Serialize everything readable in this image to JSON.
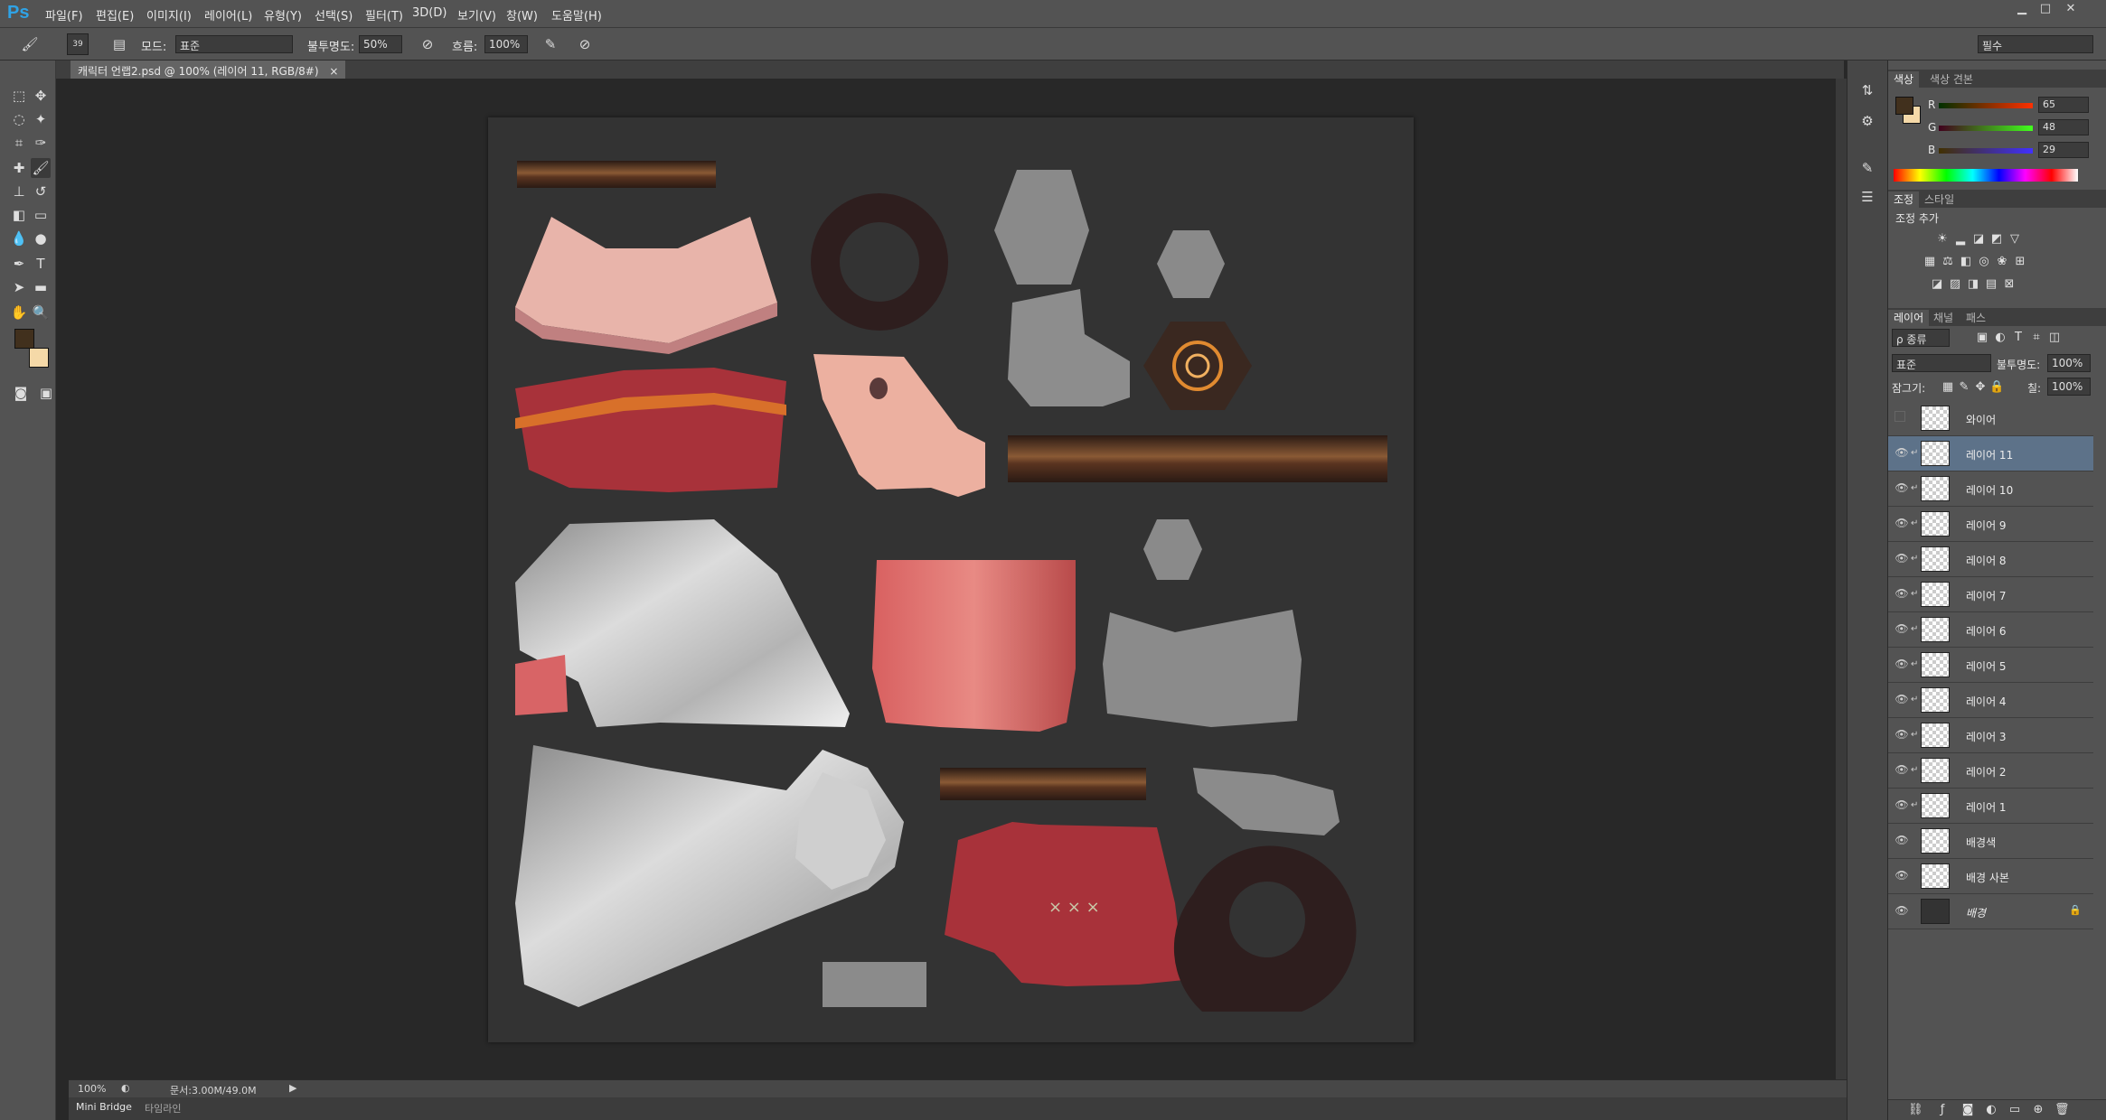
{
  "app": {
    "logo": "Ps"
  },
  "menu": [
    "파일(F)",
    "편집(E)",
    "이미지(I)",
    "레이어(L)",
    "유형(Y)",
    "선택(S)",
    "필터(T)",
    "3D(D)",
    "보기(V)",
    "창(W)",
    "도움말(H)"
  ],
  "options": {
    "brush_size": "39",
    "mode_label": "모드:",
    "mode_value": "표준",
    "opacity_label": "불투명도:",
    "opacity_value": "50%",
    "flow_label": "흐름:",
    "flow_value": "100%",
    "workspace": "필수"
  },
  "document": {
    "tab_title": "캐릭터 언랩2.psd @ 100% (레이어 11, RGB/8#)",
    "close": "×"
  },
  "status": {
    "zoom": "100%",
    "doc_info": "문서:3.00M/49.0M"
  },
  "bottom_tabs": [
    "Mini Bridge",
    "타임라인"
  ],
  "color_panel": {
    "tabs": [
      "색상",
      "색상 견본"
    ],
    "r_label": "R",
    "g_label": "G",
    "b_label": "B",
    "r": 65,
    "g": 48,
    "b": 29,
    "foreground": "#41301d",
    "background": "#f5d9a8"
  },
  "adjust_panel": {
    "tabs": [
      "조정",
      "스타일"
    ],
    "title": "조정 추가"
  },
  "layers_panel": {
    "tabs": [
      "레이어",
      "채널",
      "패스"
    ],
    "filter": "ρ 종류",
    "blend_mode": "표준",
    "opacity_label": "불투명도:",
    "opacity": "100%",
    "lock_label": "잠그기:",
    "fill_label": "칠:",
    "fill": "100%",
    "layers": [
      {
        "name": "와이어",
        "visible": false,
        "selected": false,
        "clip": false
      },
      {
        "name": "레이어 11",
        "visible": true,
        "selected": true,
        "clip": true
      },
      {
        "name": "레이어 10",
        "visible": true,
        "selected": false,
        "clip": true
      },
      {
        "name": "레이어 9",
        "visible": true,
        "selected": false,
        "clip": true
      },
      {
        "name": "레이어 8",
        "visible": true,
        "selected": false,
        "clip": true
      },
      {
        "name": "레이어 7",
        "visible": true,
        "selected": false,
        "clip": true
      },
      {
        "name": "레이어 6",
        "visible": true,
        "selected": false,
        "clip": true
      },
      {
        "name": "레이어 5",
        "visible": true,
        "selected": false,
        "clip": true
      },
      {
        "name": "레이어 4",
        "visible": true,
        "selected": false,
        "clip": true
      },
      {
        "name": "레이어 3",
        "visible": true,
        "selected": false,
        "clip": true
      },
      {
        "name": "레이어 2",
        "visible": true,
        "selected": false,
        "clip": true
      },
      {
        "name": "레이어 1",
        "visible": true,
        "selected": false,
        "clip": true
      },
      {
        "name": "배경색",
        "visible": true,
        "selected": false,
        "clip": false
      },
      {
        "name": "배경 사본",
        "visible": true,
        "selected": false,
        "clip": false
      },
      {
        "name": "배경",
        "visible": true,
        "selected": false,
        "clip": false
      }
    ]
  }
}
